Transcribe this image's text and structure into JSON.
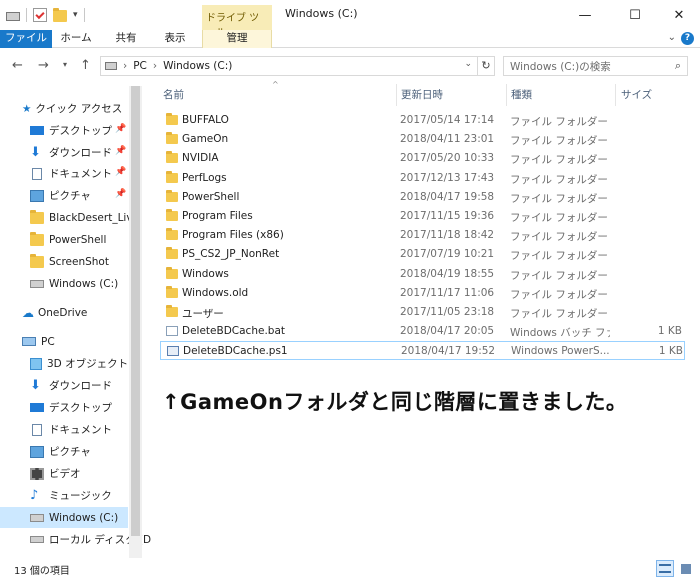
{
  "window": {
    "title": "Windows (C:)",
    "context_tab": "ドライブ ツール",
    "controls": {
      "minimize": "—",
      "maximize": "☐",
      "close": "✕"
    }
  },
  "ribbon": {
    "tabs": [
      "ファイル",
      "ホーム",
      "共有",
      "表示",
      "管理"
    ]
  },
  "address": {
    "root": "PC",
    "current": "Windows (C:)",
    "search_placeholder": "Windows (C:)の検索"
  },
  "nav": {
    "quick_access": "クイック アクセス",
    "quick_items": [
      {
        "label": "デスクトップ",
        "icon": "desktop-icon",
        "pinned": true
      },
      {
        "label": "ダウンロード",
        "icon": "download-icon",
        "pinned": true
      },
      {
        "label": "ドキュメント",
        "icon": "documents-icon",
        "pinned": true
      },
      {
        "label": "ピクチャ",
        "icon": "pictures-icon",
        "pinned": true
      },
      {
        "label": "BlackDesert_Live",
        "icon": "folder-icon",
        "pinned": false
      },
      {
        "label": "PowerShell",
        "icon": "folder-icon",
        "pinned": false
      },
      {
        "label": "ScreenShot",
        "icon": "folder-icon",
        "pinned": false
      },
      {
        "label": "Windows (C:)",
        "icon": "drive-icon",
        "pinned": false
      }
    ],
    "onedrive": "OneDrive",
    "pc": "PC",
    "pc_items": [
      {
        "label": "3D オブジェクト",
        "icon": "3d-objects-icon"
      },
      {
        "label": "ダウンロード",
        "icon": "download-icon"
      },
      {
        "label": "デスクトップ",
        "icon": "desktop-icon"
      },
      {
        "label": "ドキュメント",
        "icon": "documents-icon"
      },
      {
        "label": "ピクチャ",
        "icon": "pictures-icon"
      },
      {
        "label": "ビデオ",
        "icon": "videos-icon"
      },
      {
        "label": "ミュージック",
        "icon": "music-icon"
      },
      {
        "label": "Windows (C:)",
        "icon": "drive-icon"
      },
      {
        "label": "ローカル ディスク (D",
        "icon": "drive-icon"
      }
    ]
  },
  "columns": {
    "name": "名前",
    "date": "更新日時",
    "type": "種類",
    "size": "サイズ"
  },
  "files": [
    {
      "name": "BUFFALO",
      "date": "2017/05/14 17:14",
      "type": "ファイル フォルダー",
      "size": "",
      "kind": "folder"
    },
    {
      "name": "GameOn",
      "date": "2018/04/11 23:01",
      "type": "ファイル フォルダー",
      "size": "",
      "kind": "folder"
    },
    {
      "name": "NVIDIA",
      "date": "2017/05/20 10:33",
      "type": "ファイル フォルダー",
      "size": "",
      "kind": "folder"
    },
    {
      "name": "PerfLogs",
      "date": "2017/12/13 17:43",
      "type": "ファイル フォルダー",
      "size": "",
      "kind": "folder"
    },
    {
      "name": "PowerShell",
      "date": "2018/04/17 19:58",
      "type": "ファイル フォルダー",
      "size": "",
      "kind": "folder"
    },
    {
      "name": "Program Files",
      "date": "2017/11/15 19:36",
      "type": "ファイル フォルダー",
      "size": "",
      "kind": "folder"
    },
    {
      "name": "Program Files (x86)",
      "date": "2017/11/18 18:42",
      "type": "ファイル フォルダー",
      "size": "",
      "kind": "folder"
    },
    {
      "name": "PS_CS2_JP_NonRet",
      "date": "2017/07/19 10:21",
      "type": "ファイル フォルダー",
      "size": "",
      "kind": "folder"
    },
    {
      "name": "Windows",
      "date": "2018/04/19 18:55",
      "type": "ファイル フォルダー",
      "size": "",
      "kind": "folder"
    },
    {
      "name": "Windows.old",
      "date": "2017/11/17 11:06",
      "type": "ファイル フォルダー",
      "size": "",
      "kind": "folder"
    },
    {
      "name": "ユーザー",
      "date": "2017/11/05 23:18",
      "type": "ファイル フォルダー",
      "size": "",
      "kind": "folder"
    },
    {
      "name": "DeleteBDCache.bat",
      "date": "2018/04/17 20:05",
      "type": "Windows バッチ ファ...",
      "size": "1 KB",
      "kind": "bat"
    },
    {
      "name": "DeleteBDCache.ps1",
      "date": "2018/04/17 19:52",
      "type": "Windows PowerS...",
      "size": "1 KB",
      "kind": "ps1",
      "selected": true
    }
  ],
  "annotation": "↑GameOnフォルダと同じ階層に置きました。",
  "status": {
    "item_count": "13 個の項目"
  },
  "colors": {
    "accent": "#1979ca",
    "folder": "#f4c94e",
    "selection": "#cce8ff"
  }
}
